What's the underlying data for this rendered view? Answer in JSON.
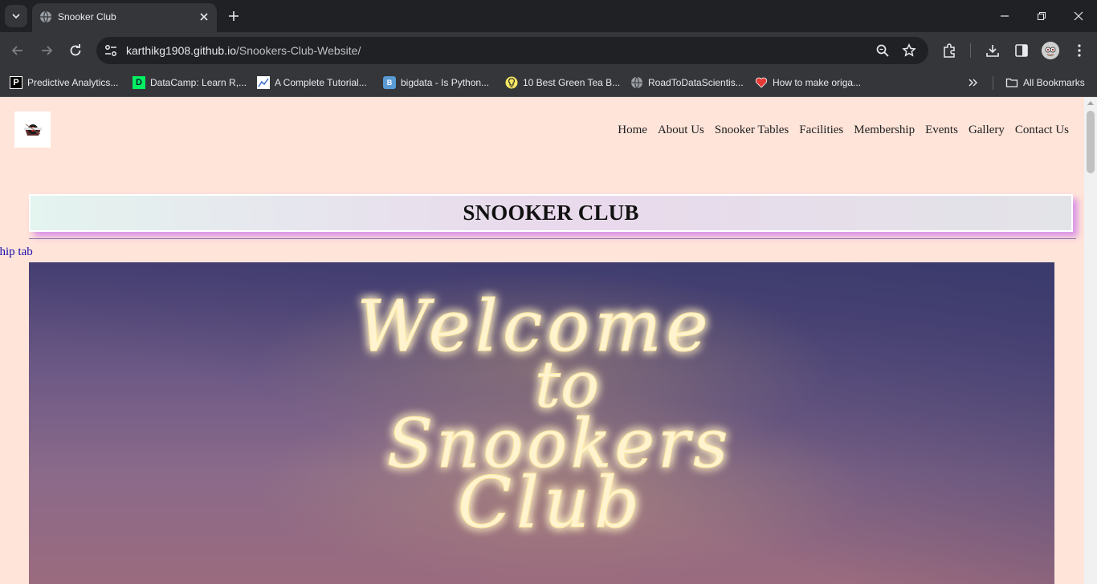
{
  "browser": {
    "tab_title": "Snooker Club",
    "url_host": "karthikg1908.github.io",
    "url_path": "/Snookers-Club-Website/",
    "bookmarks": [
      {
        "label": "Predictive Analytics...",
        "icon": "P"
      },
      {
        "label": "DataCamp: Learn R,...",
        "icon": "D"
      },
      {
        "label": "A Complete Tutorial...",
        "icon": "chart"
      },
      {
        "label": "bigdata - Is Python...",
        "icon": "B"
      },
      {
        "label": "10 Best Green Tea B...",
        "icon": "bulb"
      },
      {
        "label": "RoadToDataScientis...",
        "icon": "globe"
      },
      {
        "label": "How to make origa...",
        "icon": "heart"
      }
    ],
    "all_bookmarks_label": "All Bookmarks"
  },
  "site": {
    "nav": [
      "Home",
      "About Us",
      "Snooker Tables",
      "Facilities",
      "Membership",
      "Events",
      "Gallery",
      "Contact Us"
    ],
    "hero_title": "SNOOKER CLUB",
    "marquee": "ership tab",
    "banner_text": [
      "Welcome",
      "to",
      "Snookers",
      "Club"
    ]
  },
  "colors": {
    "page_bg": "#ffe4d9",
    "link": "#1a0dab",
    "title_shadow": "#d993e6"
  }
}
